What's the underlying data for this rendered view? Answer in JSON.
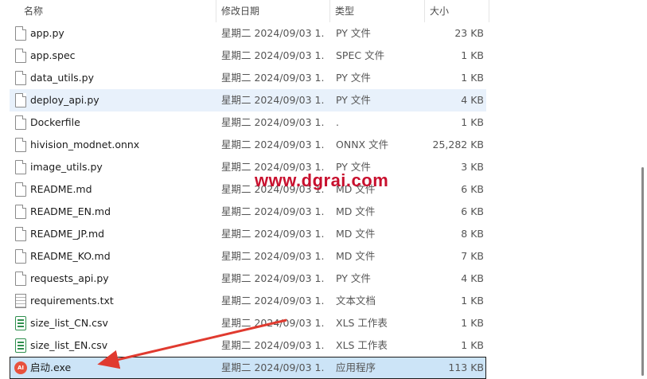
{
  "header": {
    "name": "名称",
    "date": "修改日期",
    "type": "类型",
    "size": "大小"
  },
  "files": [
    {
      "name": "app.py",
      "date": "星期二 2024/09/03 1...",
      "type": "PY 文件",
      "size": "23 KB",
      "icon": "doc"
    },
    {
      "name": "app.spec",
      "date": "星期二 2024/09/03 1...",
      "type": "SPEC 文件",
      "size": "1 KB",
      "icon": "doc"
    },
    {
      "name": "data_utils.py",
      "date": "星期二 2024/09/03 1...",
      "type": "PY 文件",
      "size": "1 KB",
      "icon": "doc"
    },
    {
      "name": "deploy_api.py",
      "date": "星期二 2024/09/03 1...",
      "type": "PY 文件",
      "size": "4 KB",
      "icon": "doc"
    },
    {
      "name": "Dockerfile",
      "date": "星期二 2024/09/03 1...",
      "type": ".",
      "size": "1 KB",
      "icon": "doc"
    },
    {
      "name": "hivision_modnet.onnx",
      "date": "星期二 2024/09/03 1...",
      "type": "ONNX 文件",
      "size": "25,282 KB",
      "icon": "doc"
    },
    {
      "name": "image_utils.py",
      "date": "星期二 2024/09/03 1...",
      "type": "PY 文件",
      "size": "3 KB",
      "icon": "doc"
    },
    {
      "name": "README.md",
      "date": "星期二 2024/09/03 1...",
      "type": "MD 文件",
      "size": "6 KB",
      "icon": "doc"
    },
    {
      "name": "README_EN.md",
      "date": "星期二 2024/09/03 1...",
      "type": "MD 文件",
      "size": "6 KB",
      "icon": "doc"
    },
    {
      "name": "README_JP.md",
      "date": "星期二 2024/09/03 1...",
      "type": "MD 文件",
      "size": "8 KB",
      "icon": "doc"
    },
    {
      "name": "README_KO.md",
      "date": "星期二 2024/09/03 1...",
      "type": "MD 文件",
      "size": "7 KB",
      "icon": "doc"
    },
    {
      "name": "requests_api.py",
      "date": "星期二 2024/09/03 1...",
      "type": "PY 文件",
      "size": "4 KB",
      "icon": "doc"
    },
    {
      "name": "requirements.txt",
      "date": "星期二 2024/09/03 1...",
      "type": "文本文档",
      "size": "1 KB",
      "icon": "txt"
    },
    {
      "name": "size_list_CN.csv",
      "date": "星期二 2024/09/03 1...",
      "type": "XLS 工作表",
      "size": "1 KB",
      "icon": "xls"
    },
    {
      "name": "size_list_EN.csv",
      "date": "星期二 2024/09/03 1...",
      "type": "XLS 工作表",
      "size": "1 KB",
      "icon": "xls"
    },
    {
      "name": "启动.exe",
      "date": "星期二 2024/09/03 1...",
      "type": "应用程序",
      "size": "113 KB",
      "icon": "exe",
      "exe_badge": "AI"
    }
  ],
  "watermark": "www.dgrai.com",
  "colors": {
    "hover_row": "#e8f1fb",
    "selected_row": "#cce4f7",
    "arrow": "#e03a2f",
    "watermark": "#c8102e"
  }
}
